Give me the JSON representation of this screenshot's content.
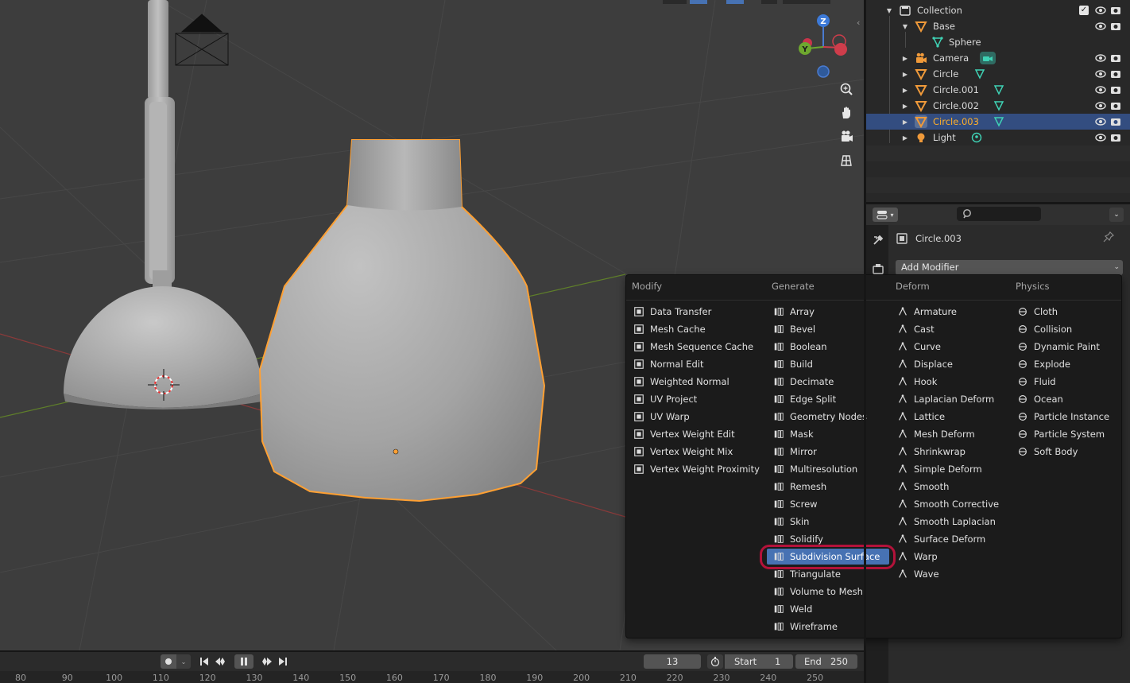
{
  "viewport": {
    "gizmo": {
      "z": "Z",
      "y": "Y"
    }
  },
  "outliner": {
    "rows": [
      {
        "label": "Collection",
        "kind": "collection"
      },
      {
        "label": "Base",
        "kind": "mesh-object"
      },
      {
        "label": "Sphere",
        "kind": "mesh-data"
      },
      {
        "label": "Camera",
        "kind": "camera-object"
      },
      {
        "label": "Circle",
        "kind": "mesh-object"
      },
      {
        "label": "Circle.001",
        "kind": "mesh-object"
      },
      {
        "label": "Circle.002",
        "kind": "mesh-object"
      },
      {
        "label": "Circle.003",
        "kind": "mesh-object",
        "selected": true
      },
      {
        "label": "Light",
        "kind": "light-object"
      }
    ],
    "collection_checked": "✓"
  },
  "properties": {
    "object_name": "Circle.003",
    "add_modifier_label": "Add Modifier",
    "search_placeholder": ""
  },
  "menu": {
    "columns": [
      {
        "heading": "Modify",
        "items": [
          "Data Transfer",
          "Mesh Cache",
          "Mesh Sequence Cache",
          "Normal Edit",
          "Weighted Normal",
          "UV Project",
          "UV Warp",
          "Vertex Weight Edit",
          "Vertex Weight Mix",
          "Vertex Weight Proximity"
        ]
      },
      {
        "heading": "Generate",
        "items": [
          "Array",
          "Bevel",
          "Boolean",
          "Build",
          "Decimate",
          "Edge Split",
          "Geometry Nodes",
          "Mask",
          "Mirror",
          "Multiresolution",
          "Remesh",
          "Screw",
          "Skin",
          "Solidify",
          "Subdivision Surface",
          "Triangulate",
          "Volume to Mesh",
          "Weld",
          "Wireframe"
        ]
      },
      {
        "heading": "Deform",
        "items": [
          "Armature",
          "Cast",
          "Curve",
          "Displace",
          "Hook",
          "Laplacian Deform",
          "Lattice",
          "Mesh Deform",
          "Shrinkwrap",
          "Simple Deform",
          "Smooth",
          "Smooth Corrective",
          "Smooth Laplacian",
          "Surface Deform",
          "Warp",
          "Wave"
        ]
      },
      {
        "heading": "Physics",
        "items": [
          "Cloth",
          "Collision",
          "Dynamic Paint",
          "Explode",
          "Fluid",
          "Ocean",
          "Particle Instance",
          "Particle System",
          "Soft Body"
        ]
      }
    ],
    "highlighted_item": "Subdivision Surface"
  },
  "timeline": {
    "current_frame": "13",
    "start_label": "Start",
    "start_value": "1",
    "end_label": "End",
    "end_value": "250",
    "ruler_ticks": [
      "80",
      "90",
      "100",
      "110",
      "120",
      "130",
      "140",
      "150",
      "160",
      "170",
      "180",
      "190",
      "200",
      "210",
      "220",
      "230",
      "240",
      "250"
    ]
  },
  "colors": {
    "viewport_bg": "#3d3d3d",
    "selection_outline": "#ffa033",
    "menu_highlight": "#4772b3",
    "annotation_ring": "#b3123a",
    "outliner_selected": "#334d80"
  }
}
